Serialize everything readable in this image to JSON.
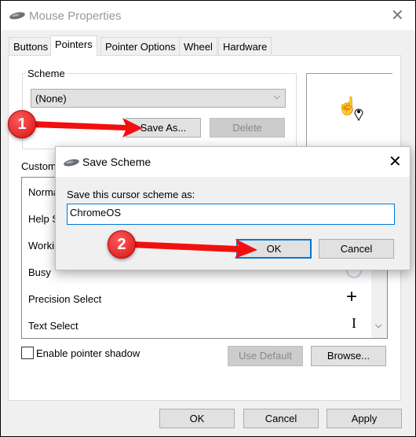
{
  "window": {
    "title": "Mouse Properties",
    "icon": "mouse-icon"
  },
  "tabs": [
    {
      "label": "Buttons"
    },
    {
      "label": "Pointers",
      "selected": true
    },
    {
      "label": "Pointer Options"
    },
    {
      "label": "Wheel"
    },
    {
      "label": "Hardware"
    }
  ],
  "scheme": {
    "legend": "Scheme",
    "selected": "(None)",
    "save_as": "Save As...",
    "delete": "Delete"
  },
  "customize": {
    "label": "Customize:",
    "items": [
      "Normal Select",
      "Help Select",
      "Working In Background",
      "Busy",
      "Precision Select",
      "Text Select"
    ]
  },
  "shadow_checkbox": {
    "label": "Enable pointer shadow",
    "checked": false
  },
  "use_default": "Use Default",
  "browse": "Browse...",
  "footer": {
    "ok": "OK",
    "cancel": "Cancel",
    "apply": "Apply"
  },
  "dialog": {
    "title": "Save Scheme",
    "prompt": "Save this cursor scheme as:",
    "value": "ChromeOS",
    "ok": "OK",
    "cancel": "Cancel"
  },
  "annotations": [
    {
      "number": "1"
    },
    {
      "number": "2"
    }
  ],
  "colors": {
    "accent": "#0078d7",
    "annotation": "#e0191b"
  }
}
